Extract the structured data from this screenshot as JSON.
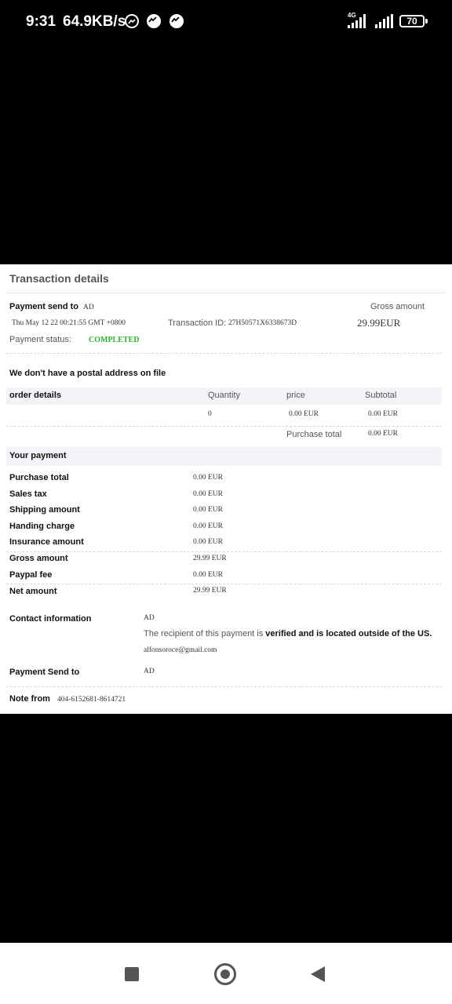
{
  "status_bar": {
    "time": "9:31",
    "net_speed": "64.9KB/s",
    "network_type": "4G",
    "battery": "70",
    "notification_icons": [
      "messenger-icon",
      "messenger-icon",
      "messenger-icon"
    ]
  },
  "transaction": {
    "title": "Transaction details",
    "payment_send_to_label": "Payment send to",
    "payment_send_to_value": "AD",
    "gross_amount_label": "Gross amount",
    "gross_amount_value": "29.99EUR",
    "date": "Thu May 12 22 00:21:55 GMT +0800",
    "transaction_id_label": "Transaction ID:",
    "transaction_id_value": "27H50571X6338673D",
    "payment_status_label": "Payment status:",
    "payment_status_value": "COMPLETED",
    "postal_notice": "We don't have a postal address on file"
  },
  "order": {
    "headers": [
      "order details",
      "Quantity",
      "price",
      "Subtotal"
    ],
    "row": {
      "quantity": "0",
      "price": "0.00 EUR",
      "subtotal": "0.00 EUR"
    },
    "purchase_total_label": "Purchase total",
    "purchase_total_value": "0.00 EUR"
  },
  "your_payment": {
    "title": "Your payment",
    "rows": [
      {
        "label": "Purchase total",
        "value": "0.00 EUR"
      },
      {
        "label": "Sales tax",
        "value": "0.00 EUR"
      },
      {
        "label": "Shipping amount",
        "value": "0.00 EUR"
      },
      {
        "label": "Handing charge",
        "value": "0.00 EUR"
      },
      {
        "label": "Insurance amount",
        "value": "0.00 EUR"
      },
      {
        "label": "Gross amount",
        "value": "29.99 EUR"
      },
      {
        "label": "Paypal fee",
        "value": "0.00 EUR"
      },
      {
        "label": "Net amount",
        "value": "29.99 EUR"
      }
    ]
  },
  "contact": {
    "label": "Contact information",
    "name": "AD",
    "verified_prefix": "The recipient of this payment is ",
    "verified_bold": "verified and is located outside of the US.",
    "email": "alfonsoroce@gmail.com",
    "send_to_label": "Payment Send to",
    "send_to_value": "AD",
    "note_label": "Note from",
    "note_value": "404-6152681-8614721"
  },
  "nav": {
    "buttons": [
      "recent-apps-button",
      "home-button",
      "back-button"
    ]
  }
}
